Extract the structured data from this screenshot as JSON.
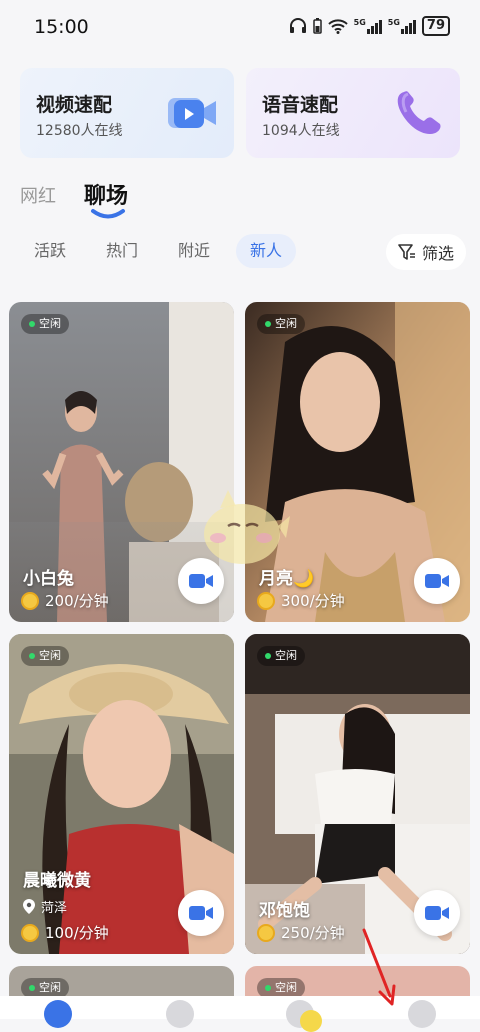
{
  "status_bar": {
    "time": "15:00",
    "signal1": "5G",
    "signal2": "5G",
    "battery": "79"
  },
  "quick_match": {
    "video": {
      "title": "视频速配",
      "subtitle": "12580人在线"
    },
    "voice": {
      "title": "语音速配",
      "subtitle": "1094人在线"
    }
  },
  "tabs": {
    "influencer": "网红",
    "chat": "聊场"
  },
  "filters": {
    "active": "活跃",
    "hot": "热门",
    "nearby": "附近",
    "new": "新人",
    "filter_button": "筛选"
  },
  "cards": [
    {
      "status": "空闲",
      "name": "小白兔",
      "price": "200/分钟"
    },
    {
      "status": "空闲",
      "name": "月亮🌙",
      "price": "300/分钟"
    },
    {
      "status": "空闲",
      "name": "晨曦微黄",
      "location": "菏泽",
      "price": "100/分钟"
    },
    {
      "status": "空闲",
      "name": "邓饱饱",
      "price": "250/分钟"
    }
  ],
  "peek_cards": [
    {
      "status": "空闲"
    },
    {
      "status": "空闲"
    }
  ],
  "colors": {
    "accent": "#3a73e6",
    "online_dot": "#32d96b",
    "coin": "#f5c842"
  }
}
